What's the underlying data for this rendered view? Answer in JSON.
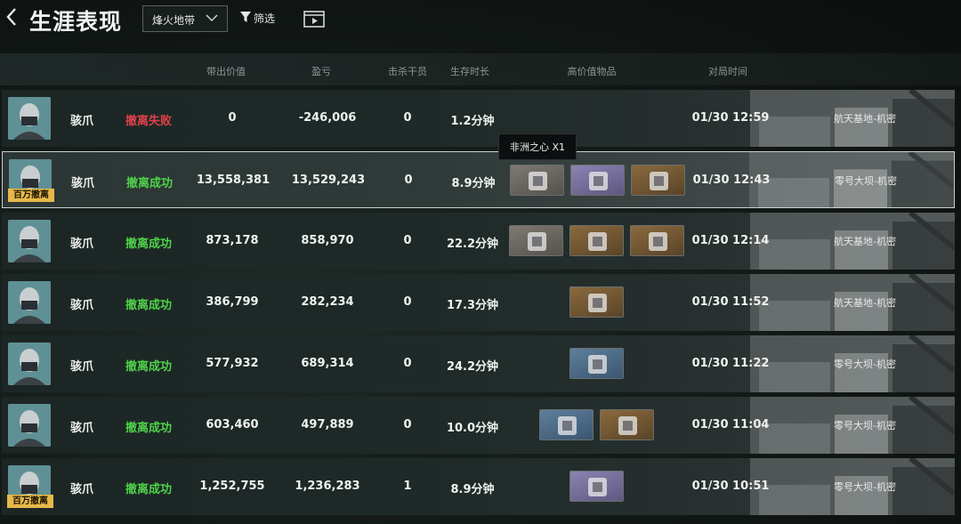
{
  "header": {
    "title": "生涯表现",
    "mode_select": "烽火地带",
    "filter_label": "筛选"
  },
  "table": {
    "columns": [
      "带出价值",
      "盈亏",
      "击杀干员",
      "生存时长",
      "高价值物品",
      "对局时间"
    ],
    "rows": [
      {
        "name": "骇爪",
        "status": "撤离失败",
        "status_type": "fail",
        "value": "0",
        "profit": "-246,006",
        "kills": "0",
        "duration": "1.2分钟",
        "time": "01/30 12:59",
        "map": "航天基地-机密",
        "badge": "",
        "items": []
      },
      {
        "name": "骇爪",
        "status": "撤离成功",
        "status_type": "ok",
        "value": "13,558,381",
        "profit": "13,529,243",
        "kills": "0",
        "duration": "8.9分钟",
        "time": "01/30 12:43",
        "map": "零号大坝-机密",
        "badge": "百万撤离",
        "items": [
          "grey",
          "purple",
          "gold"
        ]
      },
      {
        "name": "骇爪",
        "status": "撤离成功",
        "status_type": "ok",
        "value": "873,178",
        "profit": "858,970",
        "kills": "0",
        "duration": "22.2分钟",
        "time": "01/30 12:14",
        "map": "航天基地-机密",
        "badge": "",
        "items": [
          "grey",
          "gold",
          "gold"
        ]
      },
      {
        "name": "骇爪",
        "status": "撤离成功",
        "status_type": "ok",
        "value": "386,799",
        "profit": "282,234",
        "kills": "0",
        "duration": "17.3分钟",
        "time": "01/30 11:52",
        "map": "航天基地-机密",
        "badge": "",
        "items": [
          "gold"
        ]
      },
      {
        "name": "骇爪",
        "status": "撤离成功",
        "status_type": "ok",
        "value": "577,932",
        "profit": "689,314",
        "kills": "0",
        "duration": "24.2分钟",
        "time": "01/30 11:22",
        "map": "零号大坝-机密",
        "badge": "",
        "items": [
          "blue"
        ]
      },
      {
        "name": "骇爪",
        "status": "撤离成功",
        "status_type": "ok",
        "value": "603,460",
        "profit": "497,889",
        "kills": "0",
        "duration": "10.0分钟",
        "time": "01/30 11:04",
        "map": "零号大坝-机密",
        "badge": "",
        "items": [
          "blue",
          "gold"
        ]
      },
      {
        "name": "骇爪",
        "status": "撤离成功",
        "status_type": "ok",
        "value": "1,252,755",
        "profit": "1,236,283",
        "kills": "1",
        "duration": "8.9分钟",
        "time": "01/30 10:51",
        "map": "零号大坝-机密",
        "badge": "百万撤离",
        "items": [
          "purple"
        ]
      }
    ]
  },
  "tooltip": "非洲之心 X1",
  "colors": {
    "success": "#4fd24a",
    "fail": "#e0404a",
    "badge": "#e6b94a"
  }
}
